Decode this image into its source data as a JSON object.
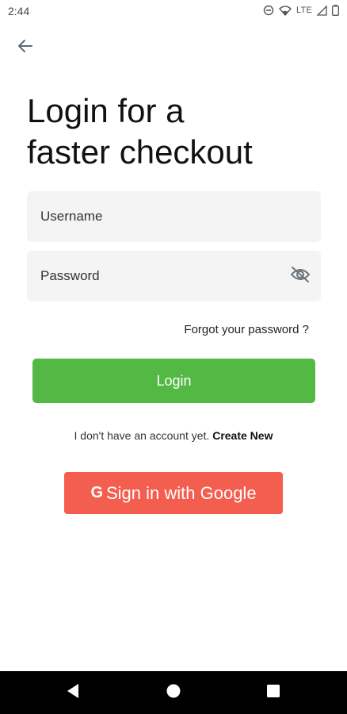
{
  "status_bar": {
    "time": "2:44",
    "network_label": "LTE",
    "icons": [
      "do-not-disturb-icon",
      "wifi-icon",
      "signal-icon",
      "battery-icon"
    ]
  },
  "header": {
    "back_icon": "arrow-left-icon"
  },
  "title": {
    "line1": "Login for a",
    "line2": "faster checkout"
  },
  "form": {
    "username_placeholder": "Username",
    "username_value": "",
    "password_placeholder": "Password",
    "password_value": "",
    "password_toggle_icon": "eye-off-icon"
  },
  "links": {
    "forgot_password": "Forgot your password ?"
  },
  "buttons": {
    "login": "Login",
    "google_g": "G",
    "google": "Sign in with Google"
  },
  "signup": {
    "prompt": "I don't have an account yet.",
    "create_new": "Create New"
  },
  "nav": {
    "icons": [
      "back-triangle-icon",
      "home-circle-icon",
      "recents-square-icon"
    ]
  },
  "colors": {
    "login_button": "#54b845",
    "google_button": "#f45e4f",
    "field_background": "#f4f4f4"
  }
}
